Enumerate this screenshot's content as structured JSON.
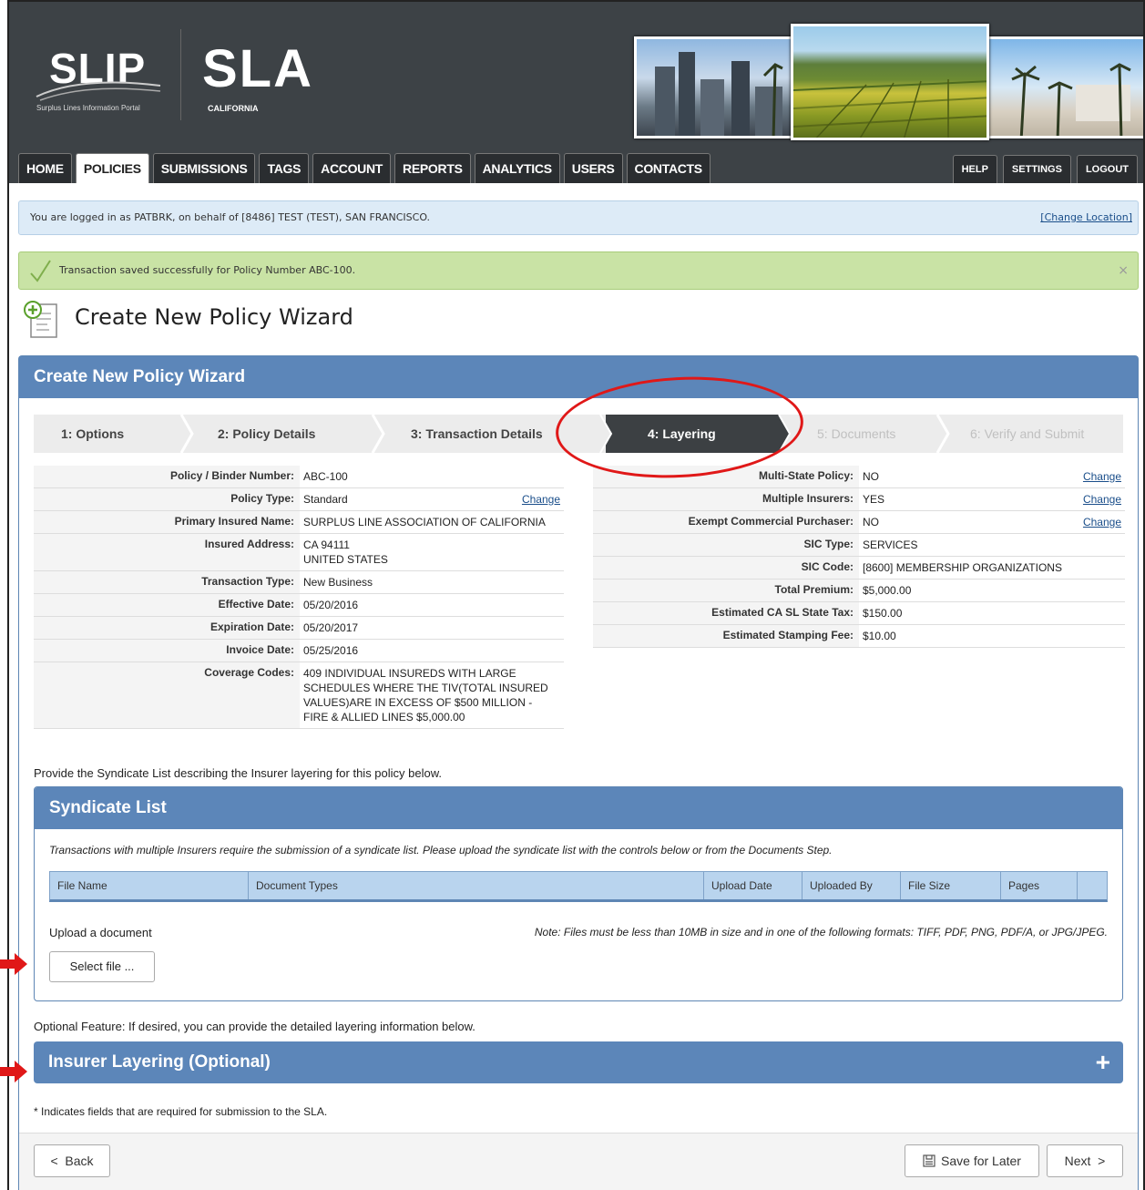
{
  "header": {
    "slip_logo": "SLIP",
    "slip_tagline": "Surplus Lines Information Portal",
    "sla_logo": "SLA",
    "sla_tagline": "CALIFORNIA",
    "tabs": [
      "HOME",
      "POLICIES",
      "SUBMISSIONS",
      "TAGS",
      "ACCOUNT",
      "REPORTS",
      "ANALYTICS",
      "USERS",
      "CONTACTS"
    ],
    "active_tab": "POLICIES",
    "right_tabs": [
      "HELP",
      "SETTINGS",
      "LOGOUT"
    ]
  },
  "info_bar": {
    "text": "You are logged in as PATBRK, on behalf of [8486] TEST (TEST), SAN FRANCISCO.",
    "link": "[Change Location]"
  },
  "success_bar": {
    "text": "Transaction saved successfully for Policy Number ABC-100.",
    "close": "×"
  },
  "page_title": "Create New Policy Wizard",
  "panel_title": "Create New Policy Wizard",
  "steps": [
    "1: Options",
    "2: Policy Details",
    "3: Transaction Details",
    "4: Layering",
    "5: Documents",
    "6: Verify and Submit"
  ],
  "active_step": "4: Layering",
  "left_details": [
    {
      "label": "Policy / Binder Number:",
      "value": "ABC-100",
      "change": ""
    },
    {
      "label": "Policy Type:",
      "value": "Standard",
      "change": "Change"
    },
    {
      "label": "Primary Insured Name:",
      "value": "SURPLUS LINE ASSOCIATION OF CALIFORNIA",
      "change": ""
    },
    {
      "label": "Insured Address:",
      "value": "CA 94111\nUNITED STATES",
      "change": ""
    },
    {
      "label": "Transaction Type:",
      "value": "New Business",
      "change": ""
    },
    {
      "label": "Effective Date:",
      "value": "05/20/2016",
      "change": ""
    },
    {
      "label": "Expiration Date:",
      "value": "05/20/2017",
      "change": ""
    },
    {
      "label": "Invoice Date:",
      "value": "05/25/2016",
      "change": ""
    },
    {
      "label": "Coverage Codes:",
      "value": "409 INDIVIDUAL INSUREDS WITH LARGE\nSCHEDULES WHERE THE TIV(TOTAL INSURED\nVALUES)ARE IN EXCESS OF $500 MILLION -\nFIRE & ALLIED LINES $5,000.00",
      "change": ""
    }
  ],
  "right_details": [
    {
      "label": "Multi-State Policy:",
      "value": "NO",
      "change": "Change"
    },
    {
      "label": "Multiple Insurers:",
      "value": "YES",
      "change": "Change"
    },
    {
      "label": "Exempt Commercial Purchaser:",
      "value": "NO",
      "change": "Change"
    },
    {
      "label": "SIC Type:",
      "value": "SERVICES",
      "change": ""
    },
    {
      "label": "SIC Code:",
      "value": "[8600] MEMBERSHIP ORGANIZATIONS",
      "change": ""
    },
    {
      "label": "Total Premium:",
      "value": "$5,000.00",
      "change": ""
    },
    {
      "label": "Estimated CA SL State Tax:",
      "value": "$150.00",
      "change": ""
    },
    {
      "label": "Estimated Stamping Fee:",
      "value": "$10.00",
      "change": ""
    }
  ],
  "syndicate": {
    "prompt": "Provide the Syndicate List describing the Insurer layering for this policy below.",
    "title": "Syndicate List",
    "note": "Transactions with multiple Insurers require the submission of a syndicate list. Please upload the syndicate list with the controls below or from the Documents Step.",
    "columns": [
      "File Name",
      "Document Types",
      "Upload Date",
      "Uploaded By",
      "File Size",
      "Pages"
    ],
    "upload_label": "Upload a document",
    "upload_note": "Note: Files must be less than 10MB in size and in one of the following formats: TIFF, PDF, PNG, PDF/A, or JPG/JPEG.",
    "select_button": "Select file ..."
  },
  "layering": {
    "prompt": "Optional Feature: If desired, you can provide the detailed layering information below.",
    "title": "Insurer Layering (Optional)",
    "expand": "+"
  },
  "required_note": "* Indicates fields that are required for submission to the SLA.",
  "footer": {
    "back": "Back",
    "save": "Save for Later",
    "next": "Next"
  },
  "colors": {
    "header_bg": "#3d4246",
    "panel_blue": "#5c86b9",
    "info_bg": "#ddebf7",
    "success_bg": "#c9e3a5",
    "annotation_red": "#e01818"
  }
}
